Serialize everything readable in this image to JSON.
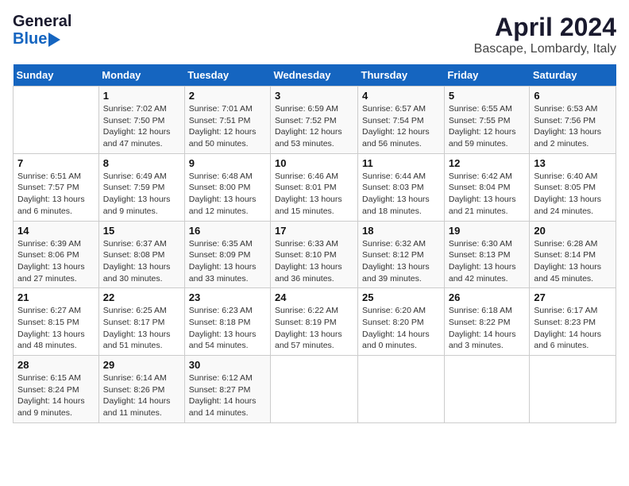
{
  "header": {
    "logo_general": "General",
    "logo_blue": "Blue",
    "title": "April 2024",
    "subtitle": "Bascape, Lombardy, Italy"
  },
  "calendar": {
    "weekdays": [
      "Sunday",
      "Monday",
      "Tuesday",
      "Wednesday",
      "Thursday",
      "Friday",
      "Saturday"
    ],
    "weeks": [
      [
        {
          "day": "",
          "info": ""
        },
        {
          "day": "1",
          "info": "Sunrise: 7:02 AM\nSunset: 7:50 PM\nDaylight: 12 hours\nand 47 minutes."
        },
        {
          "day": "2",
          "info": "Sunrise: 7:01 AM\nSunset: 7:51 PM\nDaylight: 12 hours\nand 50 minutes."
        },
        {
          "day": "3",
          "info": "Sunrise: 6:59 AM\nSunset: 7:52 PM\nDaylight: 12 hours\nand 53 minutes."
        },
        {
          "day": "4",
          "info": "Sunrise: 6:57 AM\nSunset: 7:54 PM\nDaylight: 12 hours\nand 56 minutes."
        },
        {
          "day": "5",
          "info": "Sunrise: 6:55 AM\nSunset: 7:55 PM\nDaylight: 12 hours\nand 59 minutes."
        },
        {
          "day": "6",
          "info": "Sunrise: 6:53 AM\nSunset: 7:56 PM\nDaylight: 13 hours\nand 2 minutes."
        }
      ],
      [
        {
          "day": "7",
          "info": "Sunrise: 6:51 AM\nSunset: 7:57 PM\nDaylight: 13 hours\nand 6 minutes."
        },
        {
          "day": "8",
          "info": "Sunrise: 6:49 AM\nSunset: 7:59 PM\nDaylight: 13 hours\nand 9 minutes."
        },
        {
          "day": "9",
          "info": "Sunrise: 6:48 AM\nSunset: 8:00 PM\nDaylight: 13 hours\nand 12 minutes."
        },
        {
          "day": "10",
          "info": "Sunrise: 6:46 AM\nSunset: 8:01 PM\nDaylight: 13 hours\nand 15 minutes."
        },
        {
          "day": "11",
          "info": "Sunrise: 6:44 AM\nSunset: 8:03 PM\nDaylight: 13 hours\nand 18 minutes."
        },
        {
          "day": "12",
          "info": "Sunrise: 6:42 AM\nSunset: 8:04 PM\nDaylight: 13 hours\nand 21 minutes."
        },
        {
          "day": "13",
          "info": "Sunrise: 6:40 AM\nSunset: 8:05 PM\nDaylight: 13 hours\nand 24 minutes."
        }
      ],
      [
        {
          "day": "14",
          "info": "Sunrise: 6:39 AM\nSunset: 8:06 PM\nDaylight: 13 hours\nand 27 minutes."
        },
        {
          "day": "15",
          "info": "Sunrise: 6:37 AM\nSunset: 8:08 PM\nDaylight: 13 hours\nand 30 minutes."
        },
        {
          "day": "16",
          "info": "Sunrise: 6:35 AM\nSunset: 8:09 PM\nDaylight: 13 hours\nand 33 minutes."
        },
        {
          "day": "17",
          "info": "Sunrise: 6:33 AM\nSunset: 8:10 PM\nDaylight: 13 hours\nand 36 minutes."
        },
        {
          "day": "18",
          "info": "Sunrise: 6:32 AM\nSunset: 8:12 PM\nDaylight: 13 hours\nand 39 minutes."
        },
        {
          "day": "19",
          "info": "Sunrise: 6:30 AM\nSunset: 8:13 PM\nDaylight: 13 hours\nand 42 minutes."
        },
        {
          "day": "20",
          "info": "Sunrise: 6:28 AM\nSunset: 8:14 PM\nDaylight: 13 hours\nand 45 minutes."
        }
      ],
      [
        {
          "day": "21",
          "info": "Sunrise: 6:27 AM\nSunset: 8:15 PM\nDaylight: 13 hours\nand 48 minutes."
        },
        {
          "day": "22",
          "info": "Sunrise: 6:25 AM\nSunset: 8:17 PM\nDaylight: 13 hours\nand 51 minutes."
        },
        {
          "day": "23",
          "info": "Sunrise: 6:23 AM\nSunset: 8:18 PM\nDaylight: 13 hours\nand 54 minutes."
        },
        {
          "day": "24",
          "info": "Sunrise: 6:22 AM\nSunset: 8:19 PM\nDaylight: 13 hours\nand 57 minutes."
        },
        {
          "day": "25",
          "info": "Sunrise: 6:20 AM\nSunset: 8:20 PM\nDaylight: 14 hours\nand 0 minutes."
        },
        {
          "day": "26",
          "info": "Sunrise: 6:18 AM\nSunset: 8:22 PM\nDaylight: 14 hours\nand 3 minutes."
        },
        {
          "day": "27",
          "info": "Sunrise: 6:17 AM\nSunset: 8:23 PM\nDaylight: 14 hours\nand 6 minutes."
        }
      ],
      [
        {
          "day": "28",
          "info": "Sunrise: 6:15 AM\nSunset: 8:24 PM\nDaylight: 14 hours\nand 9 minutes."
        },
        {
          "day": "29",
          "info": "Sunrise: 6:14 AM\nSunset: 8:26 PM\nDaylight: 14 hours\nand 11 minutes."
        },
        {
          "day": "30",
          "info": "Sunrise: 6:12 AM\nSunset: 8:27 PM\nDaylight: 14 hours\nand 14 minutes."
        },
        {
          "day": "",
          "info": ""
        },
        {
          "day": "",
          "info": ""
        },
        {
          "day": "",
          "info": ""
        },
        {
          "day": "",
          "info": ""
        }
      ]
    ]
  }
}
